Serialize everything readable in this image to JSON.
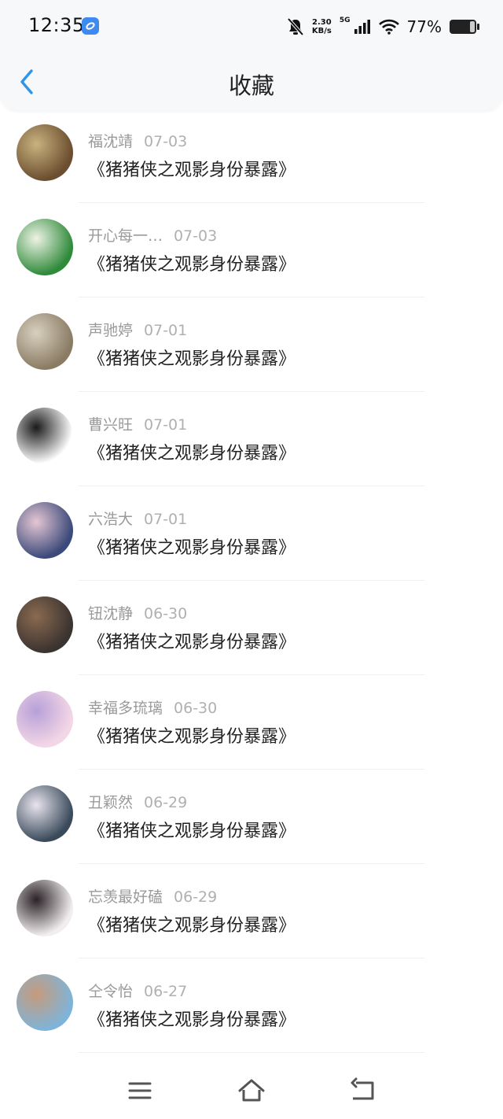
{
  "status_bar": {
    "time": "12:35",
    "net_speed_value": "2.30",
    "net_speed_unit": "KB/s",
    "network_type": "5G",
    "battery_percent": "77%",
    "icons": [
      "app-icon",
      "mute-bell-icon",
      "signal-icon",
      "wifi-icon",
      "battery-icon"
    ]
  },
  "header": {
    "title": "收藏",
    "back_icon": "chevron-left-icon",
    "accent_color": "#2f95e8"
  },
  "favorites": [
    {
      "user": "福沈靖",
      "date": "07-03",
      "title": "《猪猪侠之观影身份暴露》",
      "avatar_colors": [
        "#6b4e2f",
        "#c9b27f"
      ]
    },
    {
      "user": "开心每一…",
      "date": "07-03",
      "title": "《猪猪侠之观影身份暴露》",
      "avatar_colors": [
        "#2f8a3a",
        "#eef3e6"
      ]
    },
    {
      "user": "声驰婷",
      "date": "07-01",
      "title": "《猪猪侠之观影身份暴露》",
      "avatar_colors": [
        "#8a7b63",
        "#d8d0bf"
      ]
    },
    {
      "user": "曹兴旺",
      "date": "07-01",
      "title": "《猪猪侠之观影身份暴露》",
      "avatar_colors": [
        "#ffffff",
        "#1a1a1a"
      ]
    },
    {
      "user": "六浩大",
      "date": "07-01",
      "title": "《猪猪侠之观影身份暴露》",
      "avatar_colors": [
        "#3b4a7a",
        "#e6c6d4"
      ]
    },
    {
      "user": "钮沈静",
      "date": "06-30",
      "title": "《猪猪侠之观影身份暴露》",
      "avatar_colors": [
        "#3a3330",
        "#8b6a50"
      ]
    },
    {
      "user": "幸福多琉璃",
      "date": "06-30",
      "title": "《猪猪侠之观影身份暴露》",
      "avatar_colors": [
        "#f4d7e6",
        "#b7a0d8"
      ]
    },
    {
      "user": "丑颖然",
      "date": "06-29",
      "title": "《猪猪侠之观影身份暴露》",
      "avatar_colors": [
        "#3a4a5a",
        "#e8e4ee"
      ]
    },
    {
      "user": "忘羡最好磕",
      "date": "06-29",
      "title": "《猪猪侠之观影身份暴露》",
      "avatar_colors": [
        "#f2eef0",
        "#2a2226"
      ]
    },
    {
      "user": "仝令怡",
      "date": "06-27",
      "title": "《猪猪侠之观影身份暴露》",
      "avatar_colors": [
        "#7fb4d8",
        "#c69a7c"
      ]
    }
  ],
  "nav_bar": {
    "icons": [
      "menu-icon",
      "home-icon",
      "back-icon"
    ]
  }
}
